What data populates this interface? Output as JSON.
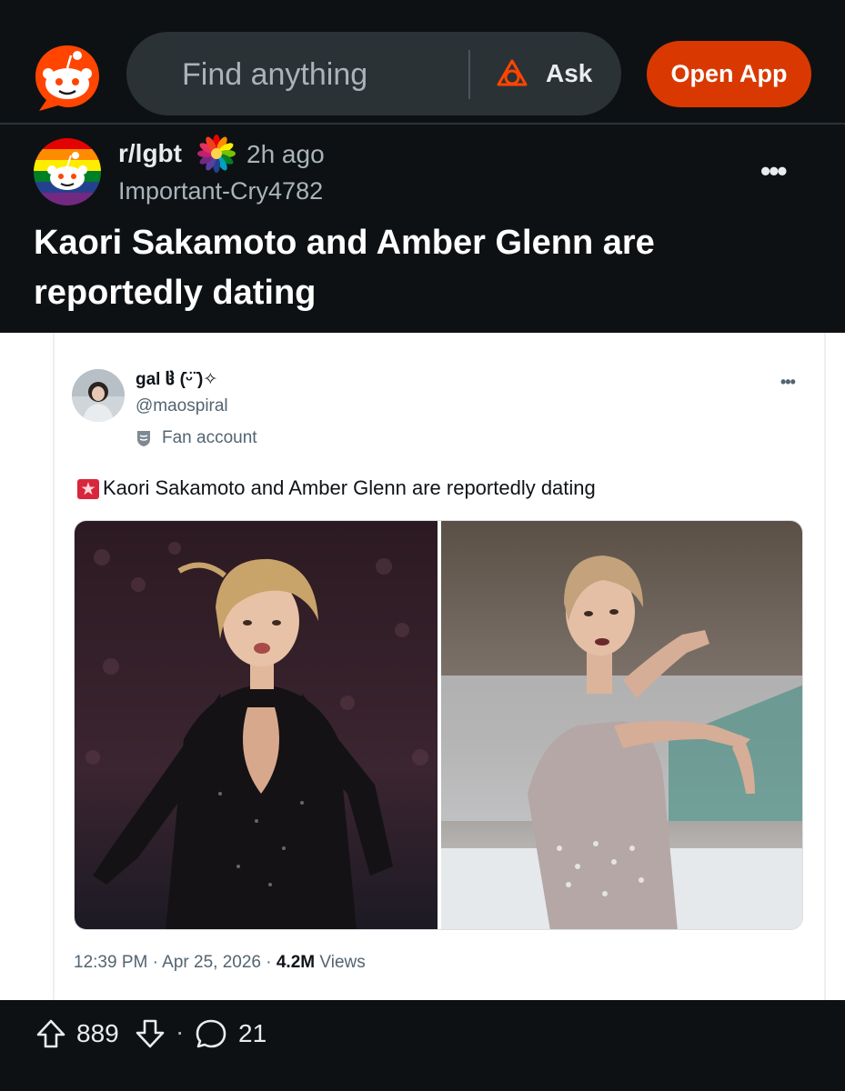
{
  "topbar": {
    "search_placeholder": "Find anything",
    "ask_label": "Ask",
    "open_app_label": "Open App",
    "accent_color": "#d93900"
  },
  "post": {
    "subreddit": "r/lgbt",
    "time": "2h ago",
    "author": "Important-Cry4782",
    "title": "Kaori Sakamoto and Amber Glenn are reportedly dating",
    "more_label": "•••"
  },
  "tweet": {
    "display_name": "gal ჱ (̇ᵕ̈ ̇)✧",
    "handle": "@maospiral",
    "badge": "Fan account",
    "text": "Kaori Sakamoto and Amber Glenn are reportedly dating",
    "more_label": "•••",
    "time": "12:39 PM · Apr 25, 2026 · ",
    "views_count": "4.2M",
    "views_label": " Views",
    "siren_icon": "police-light-icon",
    "photos": [
      {
        "alt": "figure skater in black sparkly costume"
      },
      {
        "alt": "figure skater in lavender costume"
      }
    ]
  },
  "actions": {
    "upvotes": "889",
    "separator": "·",
    "comments": "21"
  }
}
